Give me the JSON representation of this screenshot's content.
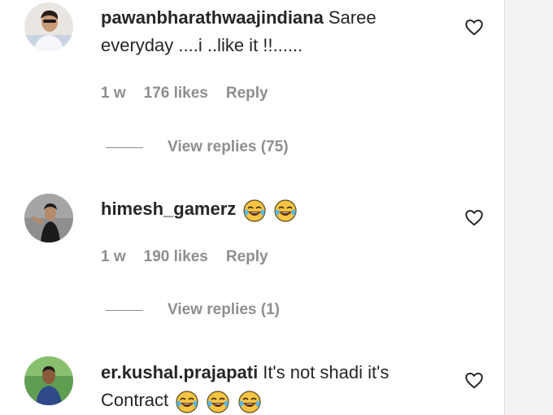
{
  "comments": [
    {
      "username": "pawanbharathwaajindiana",
      "text": "Saree everyday ....i ..like it !!......",
      "emojis": [],
      "time": "1 w",
      "likes": "176 likes",
      "reply": "Reply",
      "view_replies": "View replies (75)"
    },
    {
      "username": "himesh_gamerz",
      "text": "",
      "emojis": [
        "tears-of-joy",
        "tears-of-joy"
      ],
      "time": "1 w",
      "likes": "190 likes",
      "reply": "Reply",
      "view_replies": "View replies (1)"
    },
    {
      "username": "er.kushal.prajapati",
      "text": "It's not shadi it's Contract",
      "emojis": [
        "tears-of-joy",
        "tears-of-joy",
        "tears-of-joy"
      ]
    }
  ],
  "icons": {
    "like": "heart-outline-icon",
    "emoji": "tears-of-joy-emoji"
  },
  "colors": {
    "text": "#262626",
    "secondary": "#8e8e8e",
    "background": "#ffffff"
  }
}
